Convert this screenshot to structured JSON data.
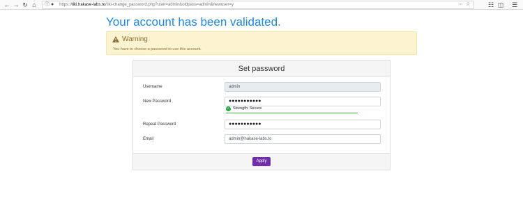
{
  "browser": {
    "url_scheme": "https://",
    "url_host": "tiki.hakase-labs.to",
    "url_path": "/tiki-change_password.php?user=admin&oldpass=admin&newuser=y"
  },
  "page": {
    "title": "Your account has been validated."
  },
  "warning": {
    "title": "Warning",
    "message": "You have to choose a password to use this account.",
    "icon": "warning-triangle-icon"
  },
  "form": {
    "heading": "Set password",
    "username_label": "Username",
    "username_value": "admin",
    "new_password_label": "New Password",
    "new_password_value": "●●●●●●●●●●●",
    "strength_text": "Strength: Secure",
    "repeat_password_label": "Repeat Password",
    "repeat_password_value": "●●●●●●●●●●●",
    "email_label": "Email",
    "email_value": "admin@hakase-labs.to",
    "apply_label": "Apply"
  },
  "colors": {
    "title": "#1e88e5",
    "warning_bg": "#fcf3d0",
    "apply_button": "#6f2da8",
    "strength_ok": "#28a745"
  }
}
